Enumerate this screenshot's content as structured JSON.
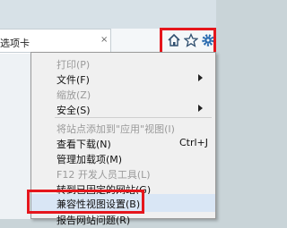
{
  "browser": {
    "tab_title": "选项卡",
    "tab_close_glyph": "×",
    "toolbar_icons": [
      "home-icon",
      "favorites-star-icon",
      "tools-gear-icon"
    ]
  },
  "menu": {
    "items": [
      {
        "label": "打印(P)",
        "disabled": true
      },
      {
        "label": "文件(F)",
        "submenu": true
      },
      {
        "label": "缩放(Z)",
        "disabled": true
      },
      {
        "label": "安全(S)",
        "submenu": true
      },
      {
        "label": "将站点添加到\"应用\"视图(I)",
        "disabled": true
      },
      {
        "label": "查看下载(N)",
        "shortcut": "Ctrl+J"
      },
      {
        "label": "管理加载项(M)"
      },
      {
        "label": "F12 开发人员工具(L)",
        "disabled": true
      },
      {
        "label": "转到已固定的网站(G)"
      },
      {
        "label": "兼容性视图设置(B)",
        "highlighted": true
      },
      {
        "label": "报告网站问题(R)"
      }
    ]
  },
  "colors": {
    "highlight_border": "#e5161c",
    "menu_background": "#f0f0f0",
    "disabled_text": "#9a9a9a"
  }
}
